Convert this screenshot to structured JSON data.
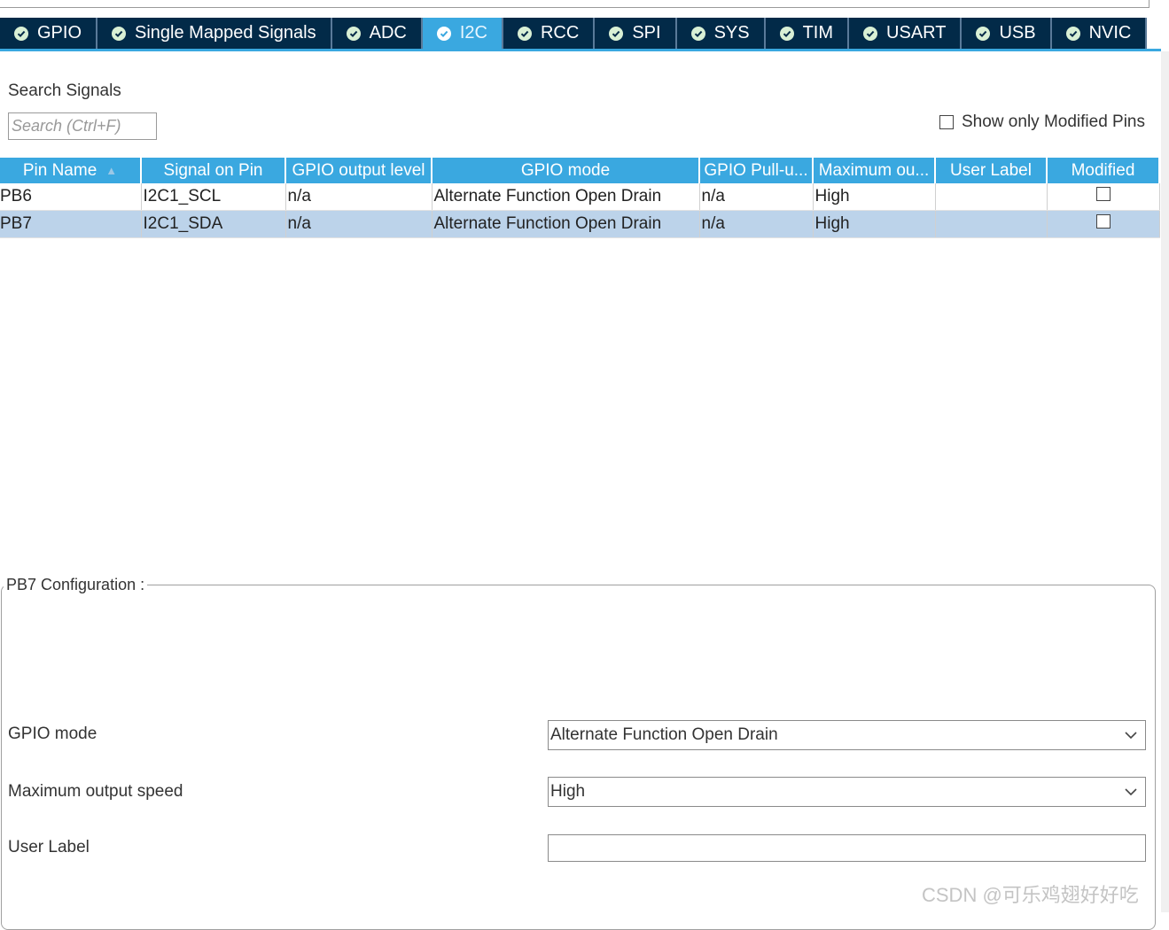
{
  "tabs": [
    {
      "label": "GPIO",
      "active": false
    },
    {
      "label": "Single Mapped Signals",
      "active": false
    },
    {
      "label": "ADC",
      "active": false
    },
    {
      "label": "I2C",
      "active": true
    },
    {
      "label": "RCC",
      "active": false
    },
    {
      "label": "SPI",
      "active": false
    },
    {
      "label": "SYS",
      "active": false
    },
    {
      "label": "TIM",
      "active": false
    },
    {
      "label": "USART",
      "active": false
    },
    {
      "label": "USB",
      "active": false
    },
    {
      "label": "NVIC",
      "active": false
    }
  ],
  "search": {
    "label": "Search Signals",
    "placeholder": "Search (Ctrl+F)",
    "show_modified_label": "Show only Modified Pins"
  },
  "table": {
    "columns": [
      "Pin Name",
      "Signal on Pin",
      "GPIO output level",
      "GPIO mode",
      "GPIO Pull-u...",
      "Maximum ou...",
      "User Label",
      "Modified"
    ],
    "rows": [
      {
        "pin": "PB6",
        "signal": "I2C1_SCL",
        "output_level": "n/a",
        "mode": "Alternate Function Open Drain",
        "pull": "n/a",
        "max_speed": "High",
        "user_label": "",
        "modified": false,
        "selected": false
      },
      {
        "pin": "PB7",
        "signal": "I2C1_SDA",
        "output_level": "n/a",
        "mode": "Alternate Function Open Drain",
        "pull": "n/a",
        "max_speed": "High",
        "user_label": "",
        "modified": false,
        "selected": true
      }
    ]
  },
  "config": {
    "title": "PB7 Configuration :",
    "gpio_mode_label": "GPIO mode",
    "gpio_mode_value": "Alternate Function Open Drain",
    "speed_label": "Maximum output speed",
    "speed_value": "High",
    "user_label_label": "User Label",
    "user_label_value": ""
  },
  "watermark": "CSDN @可乐鸡翅好好吃",
  "colors": {
    "tab_bg": "#022a48",
    "tab_active": "#3aa8e0",
    "header_bg": "#3aa8e0",
    "selected_row": "#bcd3ea"
  }
}
